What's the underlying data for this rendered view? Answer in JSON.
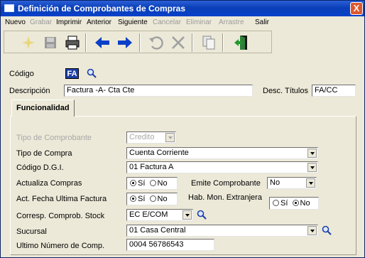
{
  "window": {
    "title": "Definición de Comprobantes de Compras",
    "close": "X"
  },
  "menu": [
    {
      "label": "Nuevo",
      "enabled": true
    },
    {
      "label": "Grabar",
      "enabled": false
    },
    {
      "label": "Imprimir",
      "enabled": true
    },
    {
      "label": "Anterior",
      "enabled": true
    },
    {
      "label": "Siguiente",
      "enabled": true
    },
    {
      "label": "Cancelar",
      "enabled": false
    },
    {
      "label": "Eliminar",
      "enabled": false
    },
    {
      "label": "Arrastre",
      "enabled": false
    },
    {
      "label": "Salir",
      "enabled": true
    }
  ],
  "header": {
    "codigo_label": "Código",
    "codigo_value": "FA",
    "descripcion_label": "Descripción",
    "descripcion_value": "Factura -A- Cta Cte",
    "desc_titulos_label": "Desc. Títulos",
    "desc_titulos_value": "FA/CC"
  },
  "tab": {
    "label": "Funcionalidad"
  },
  "form": {
    "tipo_comprobante_label": "Tipo de Comprobante",
    "tipo_comprobante_value": "Credito",
    "tipo_compra_label": "Tipo de Compra",
    "tipo_compra_value": "Cuenta Corriente",
    "codigo_dgi_label": "Código D.G.I.",
    "codigo_dgi_value": "01 Factura A",
    "actualiza_compras_label": "Actualiza Compras",
    "si_label": "Sí",
    "no_label": "No",
    "emite_comprobante_label": "Emite Comprobante",
    "emite_comprobante_value": "No",
    "act_fecha_label": "Act. Fecha Ultima Factura",
    "hab_mon_label": "Hab. Mon. Extranjera",
    "corresp_label": "Corresp. Comprob. Stock",
    "corresp_value": "EC  E/COM",
    "sucursal_label": "Sucursal",
    "sucursal_value": "01   Casa Central",
    "ultimo_numero_label": "Ultimo Número de Comp.",
    "ultimo_numero_value": "0004 56786543"
  },
  "colors": {
    "titlebar": "#0a3fb8",
    "badge": "#1e3ea6",
    "window_bg": "#ece9d8"
  }
}
